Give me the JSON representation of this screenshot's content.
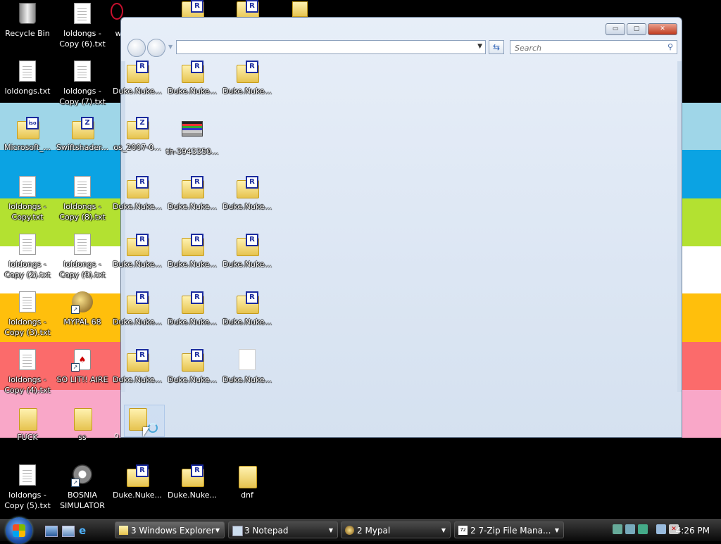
{
  "desktop": {
    "col1": [
      {
        "label": "Recycle Bin"
      },
      {
        "label": "loldongs.txt"
      },
      {
        "label": "Microsoft_..."
      },
      {
        "label": "loldongs - Copy.txt"
      },
      {
        "label": "loldongs - Copy (2).txt"
      },
      {
        "label": "loldongs - Copy (3).txt"
      },
      {
        "label": "loldongs - Copy (4).txt"
      },
      {
        "label": "FUCK"
      },
      {
        "label": "loldongs - Copy (5).txt"
      }
    ],
    "col2": [
      {
        "label": "loldongs - Copy (6).txt"
      },
      {
        "label": "loldongs - Copy (7).txt"
      },
      {
        "label": "Swiftshader..."
      },
      {
        "label": "loldongs - Copy (8).txt"
      },
      {
        "label": "loldongs - Copy (9).txt"
      },
      {
        "label": "MYPAL 68"
      },
      {
        "label": "SO LIT!! AIRE"
      },
      {
        "label": "ss"
      },
      {
        "label": "BOSNIA SIMULATOR"
      }
    ],
    "top_partial": {
      "label": "w"
    },
    "bottom_row": [
      {
        "label": "Duke.Nuke..."
      },
      {
        "label": "Duke.Nuke..."
      },
      {
        "label": "dnf"
      }
    ]
  },
  "explorer": {
    "address_value": "",
    "search_placeholder": "Search",
    "grid": [
      [
        "Duke.Nuke...",
        "Duke.Nuke...",
        "Duke.Nuke..."
      ],
      [
        "os_2007-0...",
        "th-3943350..."
      ],
      [
        "Duke.Nuke...",
        "Duke.Nuke...",
        "Duke.Nuke..."
      ],
      [
        "Duke.Nuke...",
        "Duke.Nuke...",
        "Duke.Nuke..."
      ],
      [
        "Duke.Nuke...",
        "Duke.Nuke...",
        "Duke.Nuke..."
      ],
      [
        "Duke.Nuke...",
        "Duke.Nuke...",
        "Duke.Nuke..."
      ]
    ],
    "partial_label": "o"
  },
  "taskbar": {
    "tasks": [
      {
        "label": "3 Windows Explorer"
      },
      {
        "label": "3 Notepad"
      },
      {
        "label": "2 Mypal"
      },
      {
        "label": "2 7-Zip File Mana..."
      }
    ],
    "clock": "4:26 PM"
  },
  "colors": {
    "band_black": "#000000",
    "band_lightblue": "#9fd6e8",
    "band_blue": "#0ba3e3",
    "band_green": "#b3e131",
    "band_white": "#ffffff",
    "band_orange": "#ffbf0c",
    "band_red": "#fb6b6b",
    "band_pink": "#f9a7c8"
  }
}
